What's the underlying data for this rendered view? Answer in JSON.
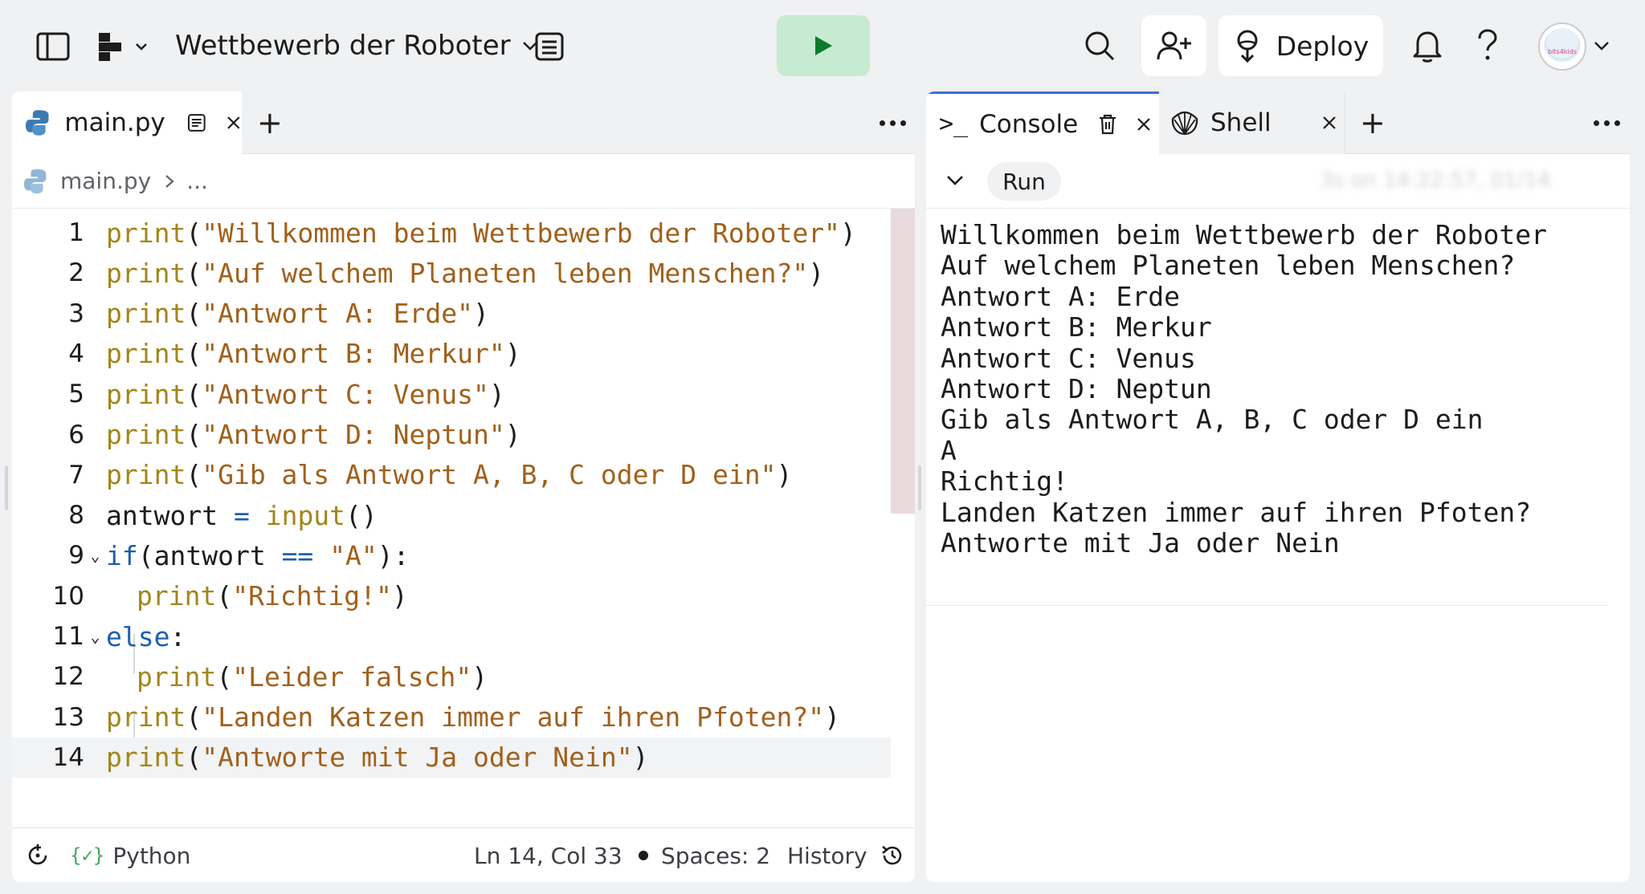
{
  "header": {
    "repl_name": "Wettbewerb der Roboter",
    "deploy_label": "Deploy",
    "avatar_text": "bits4kids"
  },
  "editor": {
    "tab_label": "main.py",
    "breadcrumb_file": "main.py",
    "breadcrumb_more": "...",
    "lines": [
      {
        "n": "1",
        "tokens": [
          {
            "t": "print",
            "c": "fn"
          },
          {
            "t": "(",
            "c": ""
          },
          {
            "t": "\"Willkommen beim Wettbewerb der Roboter\"",
            "c": "str"
          },
          {
            "t": ")",
            "c": ""
          }
        ]
      },
      {
        "n": "2",
        "tokens": [
          {
            "t": "print",
            "c": "fn"
          },
          {
            "t": "(",
            "c": ""
          },
          {
            "t": "\"Auf welchem Planeten leben Menschen?\"",
            "c": "str"
          },
          {
            "t": ")",
            "c": ""
          }
        ]
      },
      {
        "n": "3",
        "tokens": [
          {
            "t": "print",
            "c": "fn"
          },
          {
            "t": "(",
            "c": ""
          },
          {
            "t": "\"Antwort A: Erde\"",
            "c": "str"
          },
          {
            "t": ")",
            "c": ""
          }
        ]
      },
      {
        "n": "4",
        "tokens": [
          {
            "t": "print",
            "c": "fn"
          },
          {
            "t": "(",
            "c": ""
          },
          {
            "t": "\"Antwort B: Merkur\"",
            "c": "str"
          },
          {
            "t": ")",
            "c": ""
          }
        ]
      },
      {
        "n": "5",
        "tokens": [
          {
            "t": "print",
            "c": "fn"
          },
          {
            "t": "(",
            "c": ""
          },
          {
            "t": "\"Antwort C: Venus\"",
            "c": "str"
          },
          {
            "t": ")",
            "c": ""
          }
        ]
      },
      {
        "n": "6",
        "tokens": [
          {
            "t": "print",
            "c": "fn"
          },
          {
            "t": "(",
            "c": ""
          },
          {
            "t": "\"Antwort D: Neptun\"",
            "c": "str"
          },
          {
            "t": ")",
            "c": ""
          }
        ]
      },
      {
        "n": "7",
        "tokens": [
          {
            "t": "print",
            "c": "fn"
          },
          {
            "t": "(",
            "c": ""
          },
          {
            "t": "\"Gib als Antwort A, B, C oder D ein\"",
            "c": "str"
          },
          {
            "t": ")",
            "c": ""
          }
        ]
      },
      {
        "n": "8",
        "tokens": [
          {
            "t": "antwort ",
            "c": ""
          },
          {
            "t": "=",
            "c": "kw"
          },
          {
            "t": " ",
            "c": ""
          },
          {
            "t": "input",
            "c": "fn"
          },
          {
            "t": "()",
            "c": ""
          }
        ]
      },
      {
        "n": "9",
        "fold": true,
        "tokens": [
          {
            "t": "if",
            "c": "kw"
          },
          {
            "t": "(antwort ",
            "c": ""
          },
          {
            "t": "==",
            "c": "kw"
          },
          {
            "t": " ",
            "c": ""
          },
          {
            "t": "\"A\"",
            "c": "str"
          },
          {
            "t": "):",
            "c": ""
          }
        ]
      },
      {
        "n": "10",
        "indent": true,
        "tokens": [
          {
            "t": "print",
            "c": "fn"
          },
          {
            "t": "(",
            "c": ""
          },
          {
            "t": "\"Richtig!\"",
            "c": "str"
          },
          {
            "t": ")",
            "c": ""
          }
        ]
      },
      {
        "n": "11",
        "fold": true,
        "tokens": [
          {
            "t": "else",
            "c": "kw"
          },
          {
            "t": ":",
            "c": ""
          }
        ]
      },
      {
        "n": "12",
        "indent": true,
        "tokens": [
          {
            "t": "print",
            "c": "fn"
          },
          {
            "t": "(",
            "c": ""
          },
          {
            "t": "\"Leider falsch\"",
            "c": "str"
          },
          {
            "t": ")",
            "c": ""
          }
        ]
      },
      {
        "n": "13",
        "tokens": [
          {
            "t": "print",
            "c": "fn"
          },
          {
            "t": "(",
            "c": ""
          },
          {
            "t": "\"Landen Katzen immer auf ihren Pfoten?\"",
            "c": "str"
          },
          {
            "t": ")",
            "c": ""
          }
        ]
      },
      {
        "n": "14",
        "active": true,
        "tokens": [
          {
            "t": "print",
            "c": "fn"
          },
          {
            "t": "(",
            "c": ""
          },
          {
            "t": "\"Antworte mit Ja oder Nein\"",
            "c": "str"
          },
          {
            "t": ")",
            "c": ""
          }
        ]
      }
    ],
    "status": {
      "language": "Python",
      "position": "Ln 14, Col 33",
      "spaces": "Spaces: 2",
      "history": "History"
    }
  },
  "console": {
    "tab_console": "Console",
    "tab_shell": "Shell",
    "run_chip": "Run",
    "timestamp": "3s on 14:22:57, 01/14",
    "output": [
      "Willkommen beim Wettbewerb der Roboter",
      "Auf welchem Planeten leben Menschen?",
      "Antwort A: Erde",
      "Antwort B: Merkur",
      "Antwort C: Venus",
      "Antwort D: Neptun",
      "Gib als Antwort A, B, C oder D ein",
      "A",
      "Richtig!",
      "Landen Katzen immer auf ihren Pfoten?",
      "Antworte mit Ja oder Nein"
    ]
  },
  "colors": {
    "run_button_bg": "#c7ebd0",
    "run_icon": "#0a7a2b",
    "string": "#a2601b",
    "function": "#a3861a",
    "keyword": "#1e5fa8"
  }
}
